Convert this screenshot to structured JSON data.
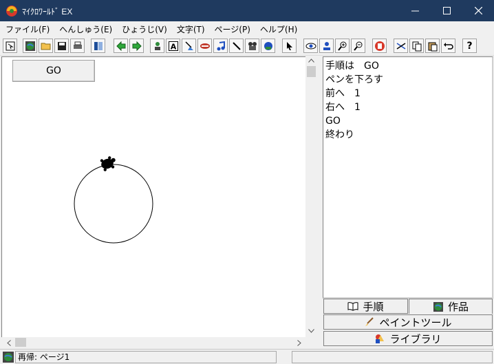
{
  "window": {
    "title": "ﾏｲｸﾛﾜｰﾙﾄﾞ EX",
    "controls": {
      "minimize": "─",
      "maximize": "☐",
      "close": "✕"
    }
  },
  "menu": [
    "ファイル(F)",
    "へんしゅう(E)",
    "ひょうじ(V)",
    "文字(T)",
    "ページ(P)",
    "ヘルプ(H)"
  ],
  "toolbar": {
    "icons": [
      "select-arrow-icon",
      "globe-icon",
      "open-folder-icon",
      "save-icon",
      "print-icon",
      "page-icon",
      "back-arrow-icon",
      "forward-arrow-icon",
      "person-icon",
      "text-box-icon",
      "broom-icon",
      "stamp-icon",
      "music-note-icon",
      "pen-icon",
      "camera-icon",
      "robot-icon",
      "pointer-icon",
      "eye-icon",
      "person-stamp-icon",
      "zoom-in-icon",
      "zoom-out-icon",
      "stop-hand-icon",
      "scissors-icon",
      "copy-icon",
      "paste-icon",
      "undo-icon",
      "help-icon"
    ],
    "help_label": "?"
  },
  "canvas": {
    "go_button": "GO",
    "drawing": {
      "shape": "circle",
      "turtle": "turtle-icon"
    }
  },
  "script": {
    "lines": [
      "手順は　GO",
      "ペンを下ろす",
      "前へ　1",
      "右へ　1",
      "GO",
      "終わり"
    ]
  },
  "tabs": {
    "steps": "手順",
    "works": "作品",
    "paint": "ペイントツール",
    "library": "ライブラリ"
  },
  "status": {
    "text": "再帰: ページ1",
    "field2": ""
  }
}
